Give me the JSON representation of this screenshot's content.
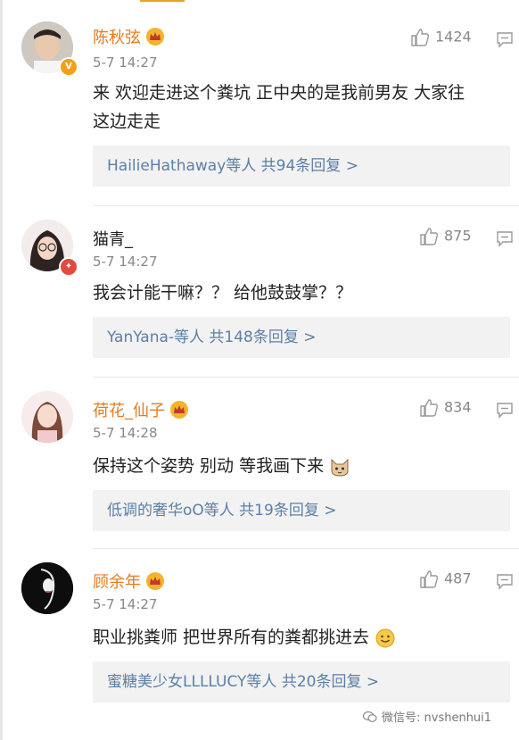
{
  "comments": [
    {
      "username": "陈秋弦",
      "time": "5-7 14:27",
      "likes": "1424",
      "text_line1": "来 欢迎走进这个粪坑 正中央的是我前男友 大家往",
      "text_line2": "这边走走",
      "replies": "HailieHathaway等人  共94条回复 >"
    },
    {
      "username": "猫青_",
      "time": "5-7 14:27",
      "likes": "875",
      "text_line1": "我会计能干嘛？？ 给他鼓鼓掌？？",
      "replies": "YanYana-等人  共148条回复 >"
    },
    {
      "username": "荷花_仙子",
      "time": "5-7 14:28",
      "likes": "834",
      "text_line1": "保持这个姿势 别动 等我画下来",
      "replies": "低调的奢华oO等人  共19条回复 >"
    },
    {
      "username": "顾余年",
      "time": "5-7 14:27",
      "likes": "487",
      "text_line1": "职业挑粪师 把世界所有的粪都挑进去",
      "replies": "蜜糖美少女LLLLUCY等人  共20条回复 >"
    }
  ],
  "watermark": "微信号: nvshenhui1",
  "colors": {
    "vip_name": "#e87a1e",
    "reply_link": "#5c7fa6",
    "crown": "#f3b42b"
  }
}
